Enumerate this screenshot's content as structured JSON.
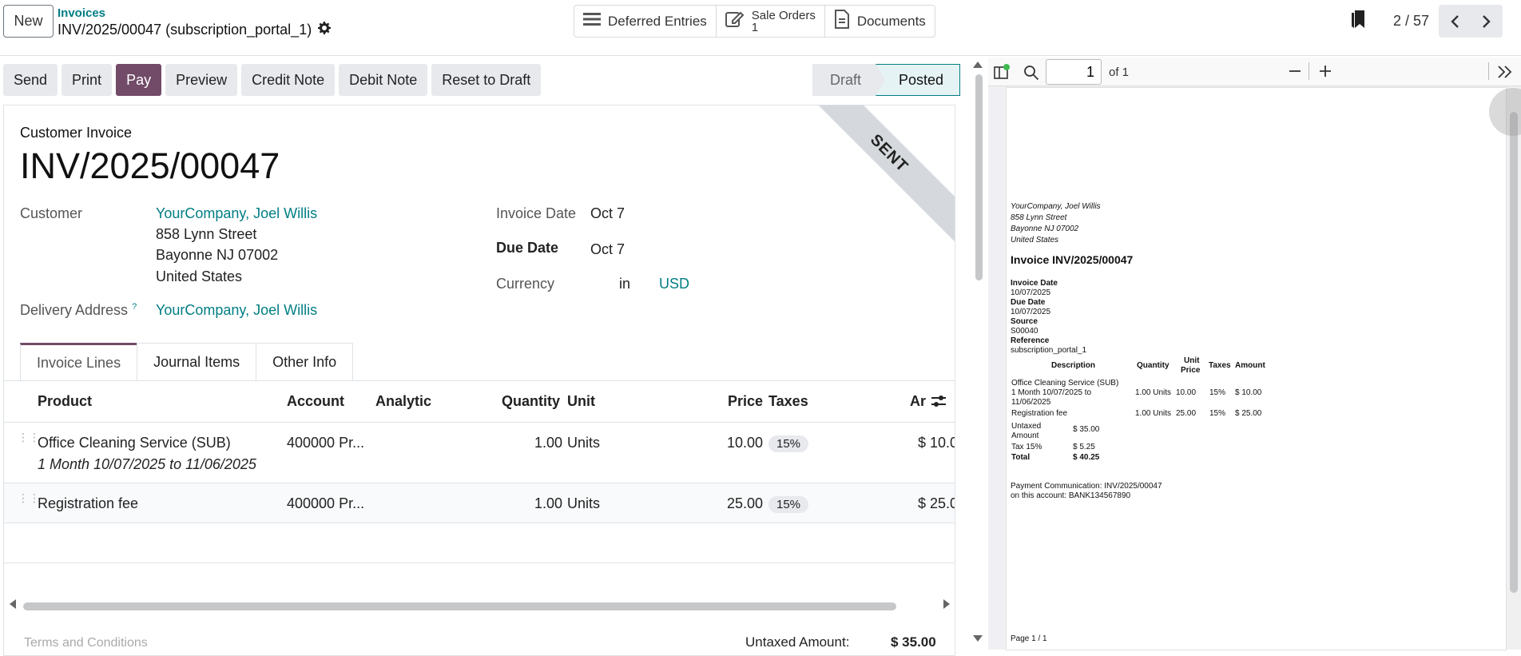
{
  "header": {
    "new_label": "New",
    "breadcrumb_parent": "Invoices",
    "record_title": "INV/2025/00047 (subscription_portal_1)",
    "smart_buttons": {
      "deferred": "Deferred Entries",
      "sale_orders": "Sale Orders",
      "sale_orders_count": "1",
      "documents": "Documents"
    },
    "pager": "2 / 57"
  },
  "actions": [
    "Send",
    "Print",
    "Pay",
    "Preview",
    "Credit Note",
    "Debit Note",
    "Reset to Draft"
  ],
  "status": {
    "draft": "Draft",
    "posted": "Posted"
  },
  "ribbon": "SENT",
  "form": {
    "type_label": "Customer Invoice",
    "number": "INV/2025/00047",
    "customer_label": "Customer",
    "customer_name": "YourCompany, Joel Willis",
    "address_1": "858 Lynn Street",
    "address_2": "Bayonne NJ 07002",
    "address_3": "United States",
    "delivery_label": "Delivery Address",
    "delivery_help": "?",
    "delivery_value": "YourCompany, Joel Willis",
    "invoice_date_label": "Invoice Date",
    "invoice_date": "Oct 7",
    "due_date_label": "Due Date",
    "due_date": "Oct 7",
    "currency_label": "Currency",
    "currency_in": "in",
    "currency": "USD"
  },
  "tabs": [
    "Invoice Lines",
    "Journal Items",
    "Other Info"
  ],
  "table": {
    "headers": [
      "Product",
      "Account",
      "Analytic",
      "Quantity",
      "Unit",
      "Price",
      "Taxes",
      "Ar"
    ],
    "rows": [
      {
        "product": "Office Cleaning Service (SUB)",
        "desc": "1 Month 10/07/2025 to 11/06/2025",
        "account": "400000 Pr...",
        "qty": "1.00",
        "unit": "Units",
        "price": "10.00",
        "tax": "15%",
        "amount": "$ 10.0"
      },
      {
        "product": "Registration fee",
        "desc": "",
        "account": "400000 Pr...",
        "qty": "1.00",
        "unit": "Units",
        "price": "25.00",
        "tax": "15%",
        "amount": "$ 25.0"
      }
    ]
  },
  "footer": {
    "terms": "Terms and Conditions",
    "untaxed_label": "Untaxed Amount:",
    "untaxed_value": "$ 35.00"
  },
  "pdf": {
    "page_input": "1",
    "page_of": "of 1",
    "addr": [
      "YourCompany, Joel Willis",
      "858 Lynn Street",
      "Bayonne NJ 07002",
      "United States"
    ],
    "title": "Invoice INV/2025/00047",
    "fields": [
      {
        "label": "Invoice Date",
        "value": "10/07/2025"
      },
      {
        "label": "Due Date",
        "value": "10/07/2025"
      },
      {
        "label": "Source",
        "value": "S00040"
      },
      {
        "label": "Reference",
        "value": "subscription_portal_1"
      }
    ],
    "col_desc": "Description",
    "col_qty": "Quantity",
    "col_unit_1": "Unit",
    "col_unit_2": "Price",
    "col_taxes": "Taxes",
    "col_amount": "Amount",
    "line1_a": "Office Cleaning Service (SUB)",
    "line1_b": "1 Month 10/07/2025 to",
    "line1_c": "11/06/2025",
    "line1_qty": "1.00 Units",
    "line1_price": "10.00",
    "line1_tax": "15%",
    "line1_amt": "$ 10.00",
    "line2": "Registration fee",
    "line2_qty": "1.00 Units",
    "line2_price": "25.00",
    "line2_tax": "15%",
    "line2_amt": "$ 25.00",
    "untaxed_1": "Untaxed",
    "untaxed_2": "Amount",
    "untaxed_val": "$ 35.00",
    "tax_label": "Tax 15%",
    "tax_val": "$ 5.25",
    "total_label": "Total",
    "total_val": "$ 40.25",
    "payment_1": "Payment Communication: INV/2025/00047",
    "payment_2": "on this account: BANK134567890",
    "page_footer": "Page 1 / 1"
  }
}
